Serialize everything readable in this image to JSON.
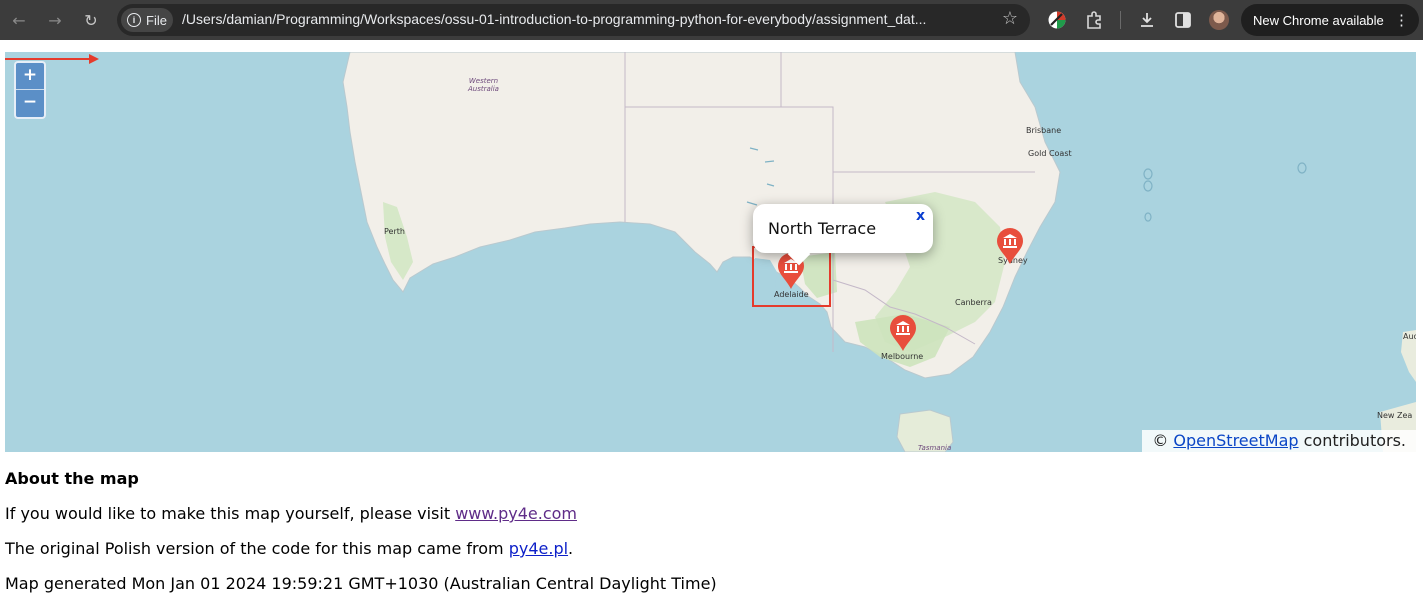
{
  "browser": {
    "chip_label": "File",
    "url": "/Users/damian/Programming/Workspaces/ossu-01-introduction-to-programming-python-for-everybody/assignment_dat...",
    "update_label": "New Chrome available",
    "icons": [
      "back-icon",
      "forward-icon",
      "reload-icon",
      "info-icon",
      "star-icon",
      "extension-icon",
      "puzzle-icon",
      "download-icon",
      "side-panel-icon",
      "avatar",
      "more-icon"
    ]
  },
  "map": {
    "zoom_in": "+",
    "zoom_out": "−",
    "popup_title": "North Terrace",
    "popup_close": "x",
    "attribution_prefix": "© ",
    "attribution_link": "OpenStreetMap",
    "attribution_suffix": " contributors.",
    "labels": {
      "western_australia_1": "Western",
      "western_australia_2": "Australia",
      "perth": "Perth",
      "adelaide": "Adelaide",
      "melbourne": "Melbourne",
      "canberra": "Canberra",
      "sydney": "Sydney",
      "brisbane": "Brisbane",
      "gold_coast": "Gold Coast",
      "auckland": "Auc",
      "new_zealand": "New Zea",
      "tasmania": "Tasmania"
    },
    "marker_color": "#e84e3c",
    "highlight_color": "#e53b2c"
  },
  "about": {
    "title": "About the map",
    "line1_prefix": "If you would like to make this map yourself, please visit ",
    "line1_link": "www.py4e.com",
    "line2_prefix": "The original Polish version of the code for this map came from ",
    "line2_link": "py4e.pl",
    "line2_suffix": ".",
    "line3": "Map generated Mon Jan 01 2024 19:59:21 GMT+1030 (Australian Central Daylight Time)"
  }
}
